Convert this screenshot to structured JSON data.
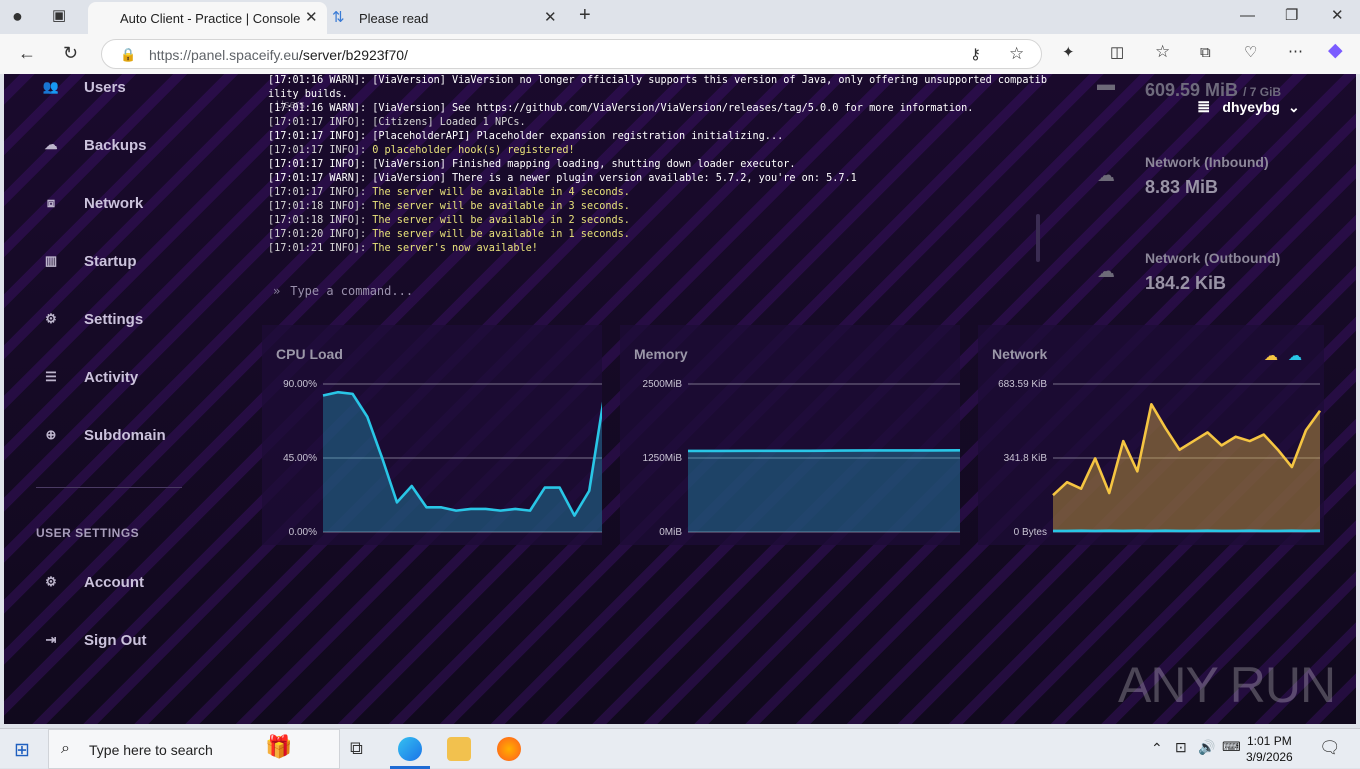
{
  "browser": {
    "tabs": [
      {
        "title": "Auto Client - Practice | Console"
      },
      {
        "title": "Please read"
      }
    ],
    "url_host": "https://panel.spaceify.eu",
    "url_path": "/server/b2923f70/"
  },
  "sidebar": {
    "items": [
      {
        "label": "Users",
        "icon": "users-icon"
      },
      {
        "label": "Backups",
        "icon": "cloud-icon"
      },
      {
        "label": "Network",
        "icon": "network-icon"
      },
      {
        "label": "Startup",
        "icon": "chart-icon"
      },
      {
        "label": "Settings",
        "icon": "cogs-icon"
      },
      {
        "label": "Activity",
        "icon": "list-icon"
      },
      {
        "label": "Subdomain",
        "icon": "globe-icon"
      }
    ],
    "user_settings_heading": "USER SETTINGS",
    "user_items": [
      {
        "label": "Account",
        "icon": "cogs-icon"
      },
      {
        "label": "Sign Out",
        "icon": "sign-out-icon"
      }
    ]
  },
  "console": {
    "lines": [
      {
        "time": "[17:01:16 WARN]:",
        "text": " [ViaVersion] ViaVersion no longer officially supports this version of Java, only offering unsupported compatib",
        "style": "bright"
      },
      {
        "time": "",
        "text": "ility builds.",
        "style": "bright"
      },
      {
        "time": "[17:01:16 WARN]:",
        "text": " [ViaVersion] See https://github.com/ViaVersion/ViaVersion/releases/tag/5.0.0 for more information.",
        "style": "bright"
      },
      {
        "time": "[17:01:17 INFO]:",
        "text": " [Citizens] Loaded 1 NPCs.",
        "style": "normal"
      },
      {
        "time": "[17:01:17 INFO]:",
        "text": " [PlaceholderAPI] Placeholder expansion registration initializing...",
        "style": "bright"
      },
      {
        "time": "[17:01:17 INFO]:",
        "text": " 0 placeholder hook(s) registered!",
        "style": "yellow"
      },
      {
        "time": "[17:01:17 INFO]:",
        "text": " [ViaVersion] Finished mapping loading, shutting down loader executor.",
        "style": "bright"
      },
      {
        "time": "[17:01:17 WARN]:",
        "text": " [ViaVersion] There is a newer plugin version available: 5.7.2, you're on: 5.7.1",
        "style": "bright"
      },
      {
        "time": "[17:01:17 INFO]:",
        "text": " The server will be available in 4 seconds.",
        "style": "yellow"
      },
      {
        "time": "[17:01:18 INFO]:",
        "text": " The server will be available in 3 seconds.",
        "style": "yellow"
      },
      {
        "time": "[17:01:18 INFO]:",
        "text": " The server will be available in 2 seconds.",
        "style": "yellow"
      },
      {
        "time": "[17:01:20 INFO]:",
        "text": " The server will be available in 1 seconds.",
        "style": "yellow"
      },
      {
        "time": "[17:01:21 INFO]:",
        "text": " The server's now available!",
        "style": "yellow"
      }
    ],
    "overlay_text": "Users",
    "command_placeholder": "Type a command..."
  },
  "stats": {
    "memory_value": "609.59 MiB",
    "memory_limit": "/ 7 GiB",
    "inbound_label": "Network (Inbound)",
    "inbound_value": "8.83 MiB",
    "outbound_label": "Network (Outbound)",
    "outbound_value": "184.2 KiB"
  },
  "user": {
    "name": "dhyeybg"
  },
  "colors": {
    "cpu": "#29c6e6",
    "memory": "#29c6e6",
    "net_in": "#f5c542",
    "net_out": "#29c6e6"
  },
  "chart_data": [
    {
      "type": "area",
      "title": "CPU Load",
      "ylim": [
        0,
        90
      ],
      "yticks": [
        "90.00%",
        "45.00%",
        "0.00%"
      ],
      "values": [
        83,
        85,
        84,
        70,
        45,
        18,
        28,
        15,
        15,
        13,
        14,
        14,
        13,
        14,
        13,
        27,
        27,
        10,
        25,
        82
      ]
    },
    {
      "type": "area",
      "title": "Memory",
      "ylim": [
        0,
        2500
      ],
      "yticks": [
        "2500MiB",
        "1250MiB",
        "0MiB"
      ],
      "values": [
        1370,
        1370,
        1372,
        1372,
        1372,
        1375,
        1378,
        1378,
        1378,
        1380
      ]
    },
    {
      "type": "area",
      "title": "Network",
      "ylim": [
        0,
        683.59
      ],
      "yticks": [
        "683.59 KiB",
        "341.8 KiB",
        "0 Bytes"
      ],
      "series": [
        {
          "values": [
            170,
            230,
            200,
            340,
            180,
            420,
            280,
            590,
            480,
            380,
            420,
            460,
            400,
            440,
            420,
            450,
            380,
            300,
            470,
            560
          ]
        },
        {
          "values": [
            5,
            5,
            6,
            5,
            6,
            5,
            6,
            5,
            6,
            5,
            5,
            6,
            5,
            5,
            6,
            5,
            5,
            6,
            5,
            6
          ]
        }
      ]
    }
  ],
  "watermark": "ANY RUN",
  "taskbar": {
    "search_placeholder": "Type here to search",
    "time": "1:01 PM",
    "date": "3/9/2026"
  }
}
